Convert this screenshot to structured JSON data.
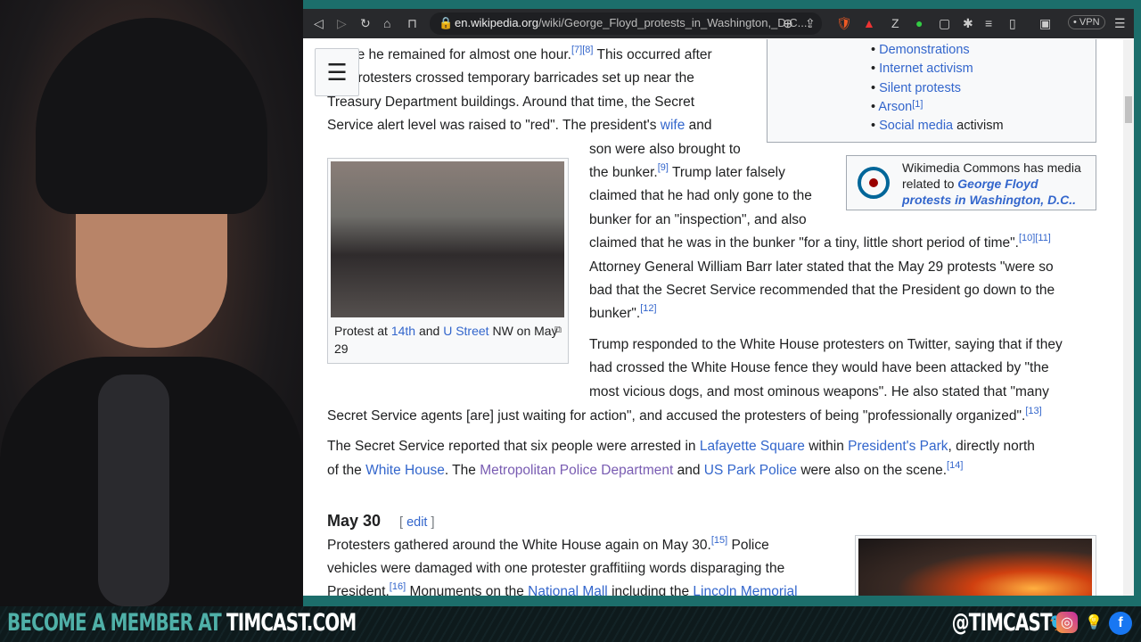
{
  "browser": {
    "url_domain": "en.wikipedia.org",
    "url_path": "/wiki/George_Floyd_protests_in_Washington,_D.C....",
    "vpn_label": "VPN"
  },
  "article": {
    "lines": [
      [
        {
          "t": "where he remained for almost one hour."
        },
        {
          "t": "[7][8]",
          "sup": 1
        },
        {
          "t": " This occurred after"
        }
      ],
      [
        {
          "t": "the protesters crossed temporary barricades set up near the"
        }
      ],
      [
        {
          "t": "Treasury Department buildings. Around that time, the Secret"
        }
      ],
      [
        {
          "t": "Service alert level was raised to \"red\". The president's "
        },
        {
          "t": "wife",
          "link": 1
        },
        {
          "t": " and"
        }
      ],
      [
        {
          "t": "son were also brought to"
        }
      ],
      [
        {
          "t": "the bunker."
        },
        {
          "t": "[9]",
          "sup": 1
        },
        {
          "t": " Trump later falsely"
        }
      ],
      [
        {
          "t": "claimed that he had only gone to the"
        }
      ],
      [
        {
          "t": "bunker for an \"inspection\", and also"
        }
      ],
      [
        {
          "t": "claimed that he was in the bunker \"for a tiny, little short period of time\"."
        },
        {
          "t": "[10][11]",
          "sup": 1
        }
      ],
      [
        {
          "t": "Attorney General William Barr later stated that the May 29 protests \"were so"
        }
      ],
      [
        {
          "t": "bad that the Secret Service recommended that the President go down to the"
        }
      ],
      [
        {
          "t": "bunker\"."
        },
        {
          "t": "[12]",
          "sup": 1
        }
      ],
      [
        {
          "t": "Trump responded to the White House protesters on Twitter, saying that if they"
        }
      ],
      [
        {
          "t": "had crossed the White House fence they would have been attacked by \"the"
        }
      ],
      [
        {
          "t": "most vicious dogs, and most ominous weapons\". He also stated that \"many"
        }
      ],
      [
        {
          "t": "Secret Service agents [are] just waiting for action\", and accused the protesters of being \"professionally organized\"."
        },
        {
          "t": "[13]",
          "sup": 1
        }
      ],
      [
        {
          "t": "The Secret Service reported that six people were arrested in "
        },
        {
          "t": "Lafayette Square",
          "link": 1
        },
        {
          "t": " within "
        },
        {
          "t": "President's Park",
          "link": 1
        },
        {
          "t": ", directly north"
        }
      ],
      [
        {
          "t": "of the "
        },
        {
          "t": "White House",
          "link": 1
        },
        {
          "t": ". The "
        },
        {
          "t": "Metropolitan Police Department",
          "link": 2
        },
        {
          "t": " and "
        },
        {
          "t": "US Park Police",
          "link": 1
        },
        {
          "t": " were also on the scene."
        },
        {
          "t": "[14]",
          "sup": 1
        }
      ],
      [
        {
          "t": "Protesters gathered around the White House again on May 30."
        },
        {
          "t": "[15]",
          "sup": 1
        },
        {
          "t": " Police"
        }
      ],
      [
        {
          "t": "vehicles were damaged with one protester graffitiing words disparaging the"
        }
      ],
      [
        {
          "t": "President."
        },
        {
          "t": "[16]",
          "sup": 1
        },
        {
          "t": " Monuments on the "
        },
        {
          "t": "National Mall",
          "link": 1
        },
        {
          "t": " including the "
        },
        {
          "t": "Lincoln Memorial",
          "link": 1
        }
      ]
    ],
    "section_heading": "May 30",
    "edit_label": "edit"
  },
  "navbox": {
    "items": [
      "Demonstrations",
      "Internet activism",
      "Silent protests",
      "Arson",
      "Social media"
    ],
    "arson_ref": "[1]",
    "social_suffix": " activism"
  },
  "commons": {
    "text": "Wikimedia Commons has media related to ",
    "link": "George Floyd protests in Washington, D.C.."
  },
  "figure": {
    "cap_a": "Protest at ",
    "link1": "14th",
    "cap_b": " and ",
    "link2": "U Street",
    "cap_c": " NW on May 29"
  },
  "banner": {
    "left_a": "BECOME A MEMBER AT ",
    "left_b": "TIMCAST.COM",
    "right": "@TIMCAST"
  },
  "colors": {
    "link": "#3366cc",
    "visited": "#795cb2",
    "frame": "#1c6e6b"
  }
}
